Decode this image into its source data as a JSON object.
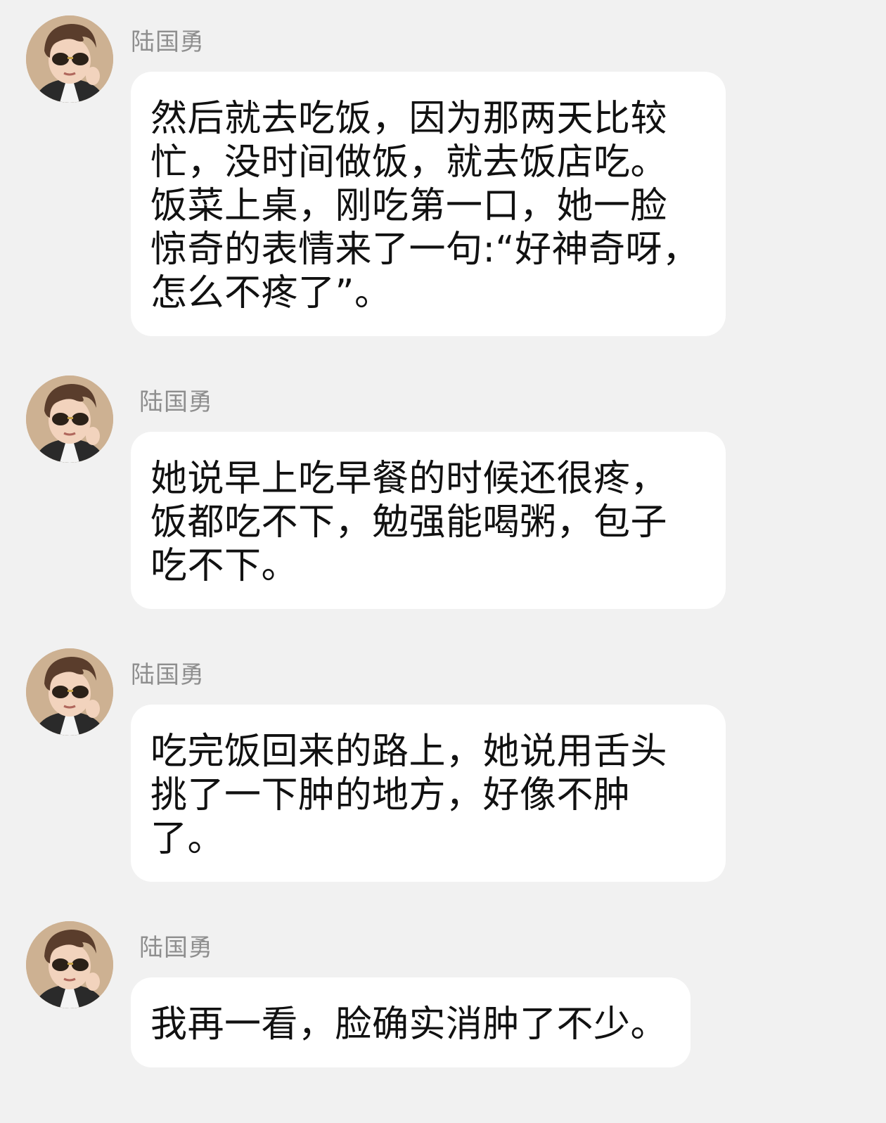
{
  "messages": [
    {
      "sender": "陆国勇",
      "avatar": "boy-with-sunglasses-avatar",
      "text": "然后就去吃饭，因为那两天比较\n忙，没时间做饭，就去饭店吃。\n饭菜上桌，刚吃第一口，她一脸\n惊奇的表情来了一句:“好神奇呀，\n怎么不疼了”。"
    },
    {
      "sender": "陆国勇",
      "avatar": "boy-with-sunglasses-avatar",
      "text": "她说早上吃早餐的时候还很疼，\n饭都吃不下，勉强能喝粥，包子\n吃不下。"
    },
    {
      "sender": "陆国勇",
      "avatar": "boy-with-sunglasses-avatar",
      "text": "吃完饭回来的路上，她说用舌头\n挑了一下肿的地方，好像不肿\n了。"
    },
    {
      "sender": "陆国勇",
      "avatar": "boy-with-sunglasses-avatar",
      "text": "我再一看，脸确实消肿了不少。"
    }
  ]
}
